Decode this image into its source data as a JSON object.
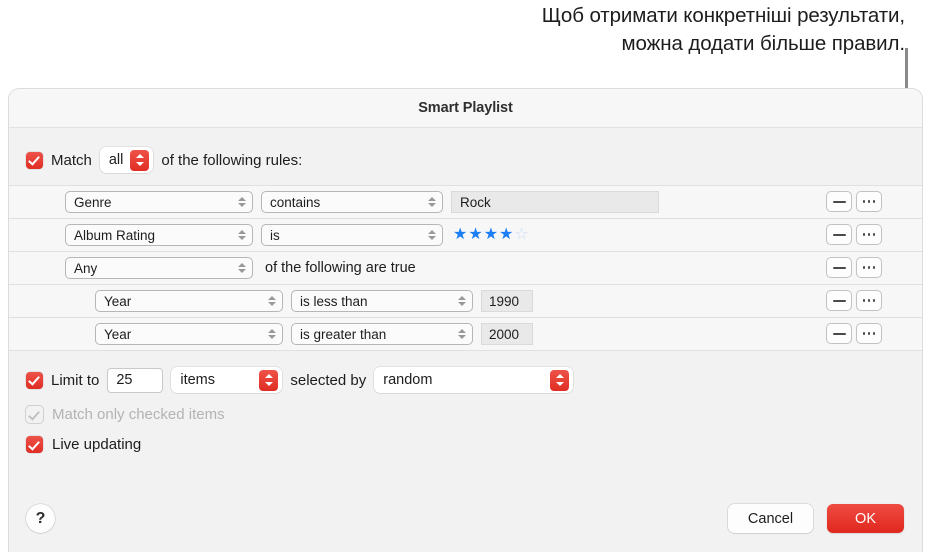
{
  "callout": {
    "line1": "Щоб отримати конкретніші результати,",
    "line2": "можна додати більше правил."
  },
  "dialog": {
    "title": "Smart Playlist",
    "match": {
      "checkbox_checked": true,
      "label": "Match",
      "selector_value": "all",
      "suffix": "of the following rules:"
    },
    "rules": [
      {
        "field": "Genre",
        "operator": "contains",
        "value": "Rock",
        "value_type": "text",
        "indent": false,
        "remove_label": "−",
        "more_label": "···"
      },
      {
        "field": "Album Rating",
        "operator": "is",
        "value": "4",
        "value_type": "stars",
        "stars_filled": 4,
        "stars_total": 5,
        "indent": false,
        "remove_label": "−",
        "more_label": "···"
      },
      {
        "field": "Any",
        "operator": "",
        "value": "of the following are true",
        "value_type": "group",
        "indent": false,
        "remove_label": "−",
        "more_label": "···"
      },
      {
        "field": "Year",
        "operator": "is less than",
        "value": "1990",
        "value_type": "number",
        "indent": true,
        "remove_label": "−",
        "more_label": "···"
      },
      {
        "field": "Year",
        "operator": "is greater than",
        "value": "2000",
        "value_type": "number",
        "indent": true,
        "remove_label": "−",
        "more_label": "···"
      }
    ],
    "limit": {
      "checkbox_checked": true,
      "label": "Limit to",
      "amount": "25",
      "unit": "items",
      "middle_label": "selected by",
      "sort_by": "random"
    },
    "match_only_checked": {
      "label": "Match only checked items",
      "checked": true,
      "disabled": true
    },
    "live_updating": {
      "label": "Live updating",
      "checked": true
    },
    "footer": {
      "help_label": "?",
      "cancel_label": "Cancel",
      "ok_label": "OK"
    }
  },
  "colors": {
    "accent_red": "#e0281e",
    "star_blue": "#1b7ef5",
    "dialog_bg": "#f2f2f2"
  }
}
